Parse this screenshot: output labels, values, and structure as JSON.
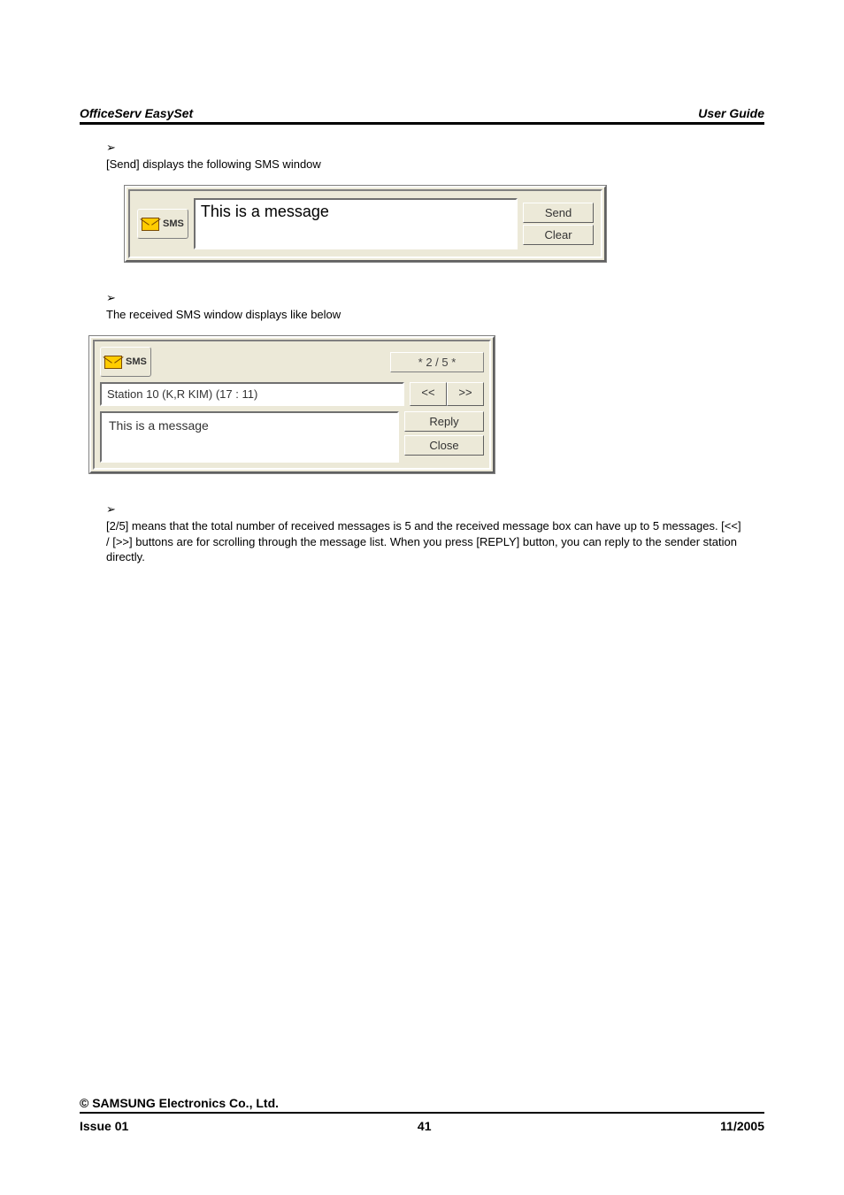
{
  "header": {
    "product": "OfficeServ EasySet",
    "guide": "User Guide"
  },
  "bullets": {
    "send_desc": "[Send] displays the following SMS window",
    "recv_desc": "The received SMS window displays like below",
    "count_desc": "[2/5] means that the total number of received messages is 5 and the received message box can have up to 5 messages. [<<] / [>>] buttons are for scrolling through the message list. When you press [REPLY] button, you can reply to the sender station directly."
  },
  "sms_send": {
    "badge": "SMS",
    "message": "This is a message",
    "send_label": "Send",
    "clear_label": "Clear"
  },
  "sms_recv": {
    "badge": "SMS",
    "counter": "* 2 / 5 *",
    "station": "Station    10 (K,R KIM) (17 : 11)",
    "prev": "<<",
    "next": ">>",
    "message": "This is a message",
    "reply_label": "Reply",
    "close_label": "Close"
  },
  "footer": {
    "copyright": "© SAMSUNG Electronics Co., Ltd.",
    "issue": "Issue 01",
    "page": "41",
    "date": "11/2005"
  }
}
